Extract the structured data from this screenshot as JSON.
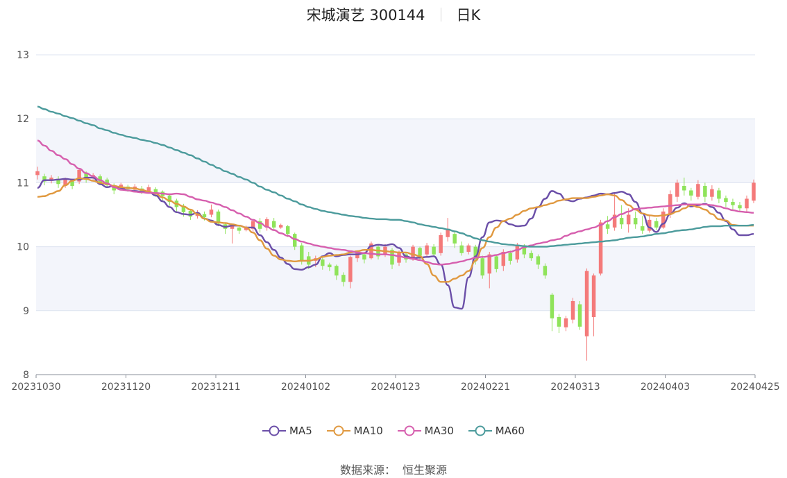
{
  "title": {
    "name": "宋城演艺 300144",
    "period": "日K"
  },
  "source": {
    "label": "数据来源：",
    "value": "恒生聚源"
  },
  "colors": {
    "up": "#f47a7a",
    "down": "#8fe35a",
    "band": "#f3f5fb",
    "grid": "#dde3f0",
    "axis": "#8a8f99"
  },
  "chart_data": {
    "type": "candlestick",
    "ylim": [
      8,
      13
    ],
    "yticks": [
      8,
      9,
      10,
      11,
      12,
      13
    ],
    "xticks": [
      "20231030",
      "20231120",
      "20231211",
      "20240102",
      "20240123",
      "20240221",
      "20240313",
      "20240403",
      "20240425"
    ],
    "series": [
      {
        "name": "MA5",
        "color": "#6b4fa8",
        "values": [
          10.92,
          11.04,
          11.04,
          11.05,
          11.06,
          11.05,
          11.05,
          11.08,
          11.08,
          10.98,
          10.93,
          10.95,
          10.92,
          10.88,
          10.87,
          10.86,
          10.86,
          10.8,
          10.71,
          10.62,
          10.54,
          10.51,
          10.5,
          10.53,
          10.44,
          10.41,
          10.34,
          10.31,
          10.33,
          10.33,
          10.3,
          10.3,
          10.18,
          10.07,
          9.95,
          9.83,
          9.73,
          9.65,
          9.64,
          9.68,
          9.72,
          9.85,
          9.9,
          9.85,
          9.87,
          9.88,
          9.88,
          9.9,
          10.01,
          10.03,
          10.02,
          10.04,
          9.98,
          9.85,
          9.82,
          9.83,
          9.84,
          9.85,
          9.72,
          9.4,
          9.05,
          9.03,
          9.52,
          9.85,
          10.15,
          10.38,
          10.41,
          10.4,
          10.35,
          10.32,
          10.33,
          10.44,
          10.62,
          10.75,
          10.87,
          10.83,
          10.73,
          10.71,
          10.75,
          10.77,
          10.8,
          10.83,
          10.82,
          10.84,
          10.86,
          10.82,
          10.7,
          10.52,
          10.3,
          10.23,
          10.36,
          10.51,
          10.61,
          10.68,
          10.63,
          10.65,
          10.67,
          10.62,
          10.53,
          10.4,
          10.27,
          10.18,
          10.18,
          10.2
        ]
      },
      {
        "name": "MA10",
        "color": "#e09940",
        "values": [
          10.78,
          10.79,
          10.83,
          10.87,
          10.96,
          11.03,
          11.07,
          11.06,
          11.03,
          11.0,
          10.98,
          10.95,
          10.93,
          10.92,
          10.91,
          10.89,
          10.86,
          10.83,
          10.77,
          10.72,
          10.67,
          10.63,
          10.58,
          10.51,
          10.44,
          10.39,
          10.38,
          10.37,
          10.35,
          10.33,
          10.3,
          10.22,
          10.1,
          9.97,
          9.86,
          9.8,
          9.78,
          9.77,
          9.78,
          9.78,
          9.8,
          9.84,
          9.86,
          9.87,
          9.88,
          9.91,
          9.93,
          9.95,
          9.95,
          9.94,
          9.93,
          9.92,
          9.91,
          9.91,
          9.88,
          9.85,
          9.73,
          9.55,
          9.45,
          9.45,
          9.5,
          9.55,
          9.62,
          9.78,
          9.98,
          10.15,
          10.3,
          10.4,
          10.44,
          10.5,
          10.56,
          10.6,
          10.62,
          10.65,
          10.68,
          10.72,
          10.74,
          10.76,
          10.76,
          10.76,
          10.78,
          10.8,
          10.82,
          10.8,
          10.73,
          10.65,
          10.58,
          10.52,
          10.49,
          10.48,
          10.49,
          10.51,
          10.55,
          10.6,
          10.65,
          10.62,
          10.58,
          10.51,
          10.43,
          10.41,
          10.34,
          10.33,
          10.33,
          10.33
        ]
      },
      {
        "name": "MA30",
        "color": "#d65fae",
        "values": [
          11.66,
          11.58,
          11.5,
          11.43,
          11.37,
          11.29,
          11.22,
          11.15,
          11.1,
          11.04,
          10.99,
          10.93,
          10.89,
          10.88,
          10.86,
          10.85,
          10.84,
          10.84,
          10.83,
          10.82,
          10.83,
          10.82,
          10.78,
          10.74,
          10.72,
          10.69,
          10.66,
          10.62,
          10.57,
          10.52,
          10.47,
          10.42,
          10.37,
          10.31,
          10.26,
          10.21,
          10.17,
          10.12,
          10.08,
          10.05,
          10.02,
          10.0,
          9.98,
          9.96,
          9.95,
          9.93,
          9.91,
          9.9,
          9.89,
          9.88,
          9.88,
          9.87,
          9.85,
          9.83,
          9.81,
          9.79,
          9.76,
          9.73,
          9.72,
          9.73,
          9.75,
          9.77,
          9.8,
          9.83,
          9.84,
          9.85,
          9.87,
          9.9,
          9.92,
          9.95,
          9.99,
          10.02,
          10.05,
          10.07,
          10.1,
          10.12,
          10.17,
          10.21,
          10.24,
          10.27,
          10.3,
          10.34,
          10.4,
          10.46,
          10.51,
          10.55,
          10.59,
          10.6,
          10.61,
          10.62,
          10.63,
          10.64,
          10.65,
          10.66,
          10.66,
          10.66,
          10.66,
          10.65,
          10.63,
          10.6,
          10.57,
          10.55,
          10.54,
          10.53
        ]
      },
      {
        "name": "MA60",
        "color": "#4c9b9c",
        "values": [
          12.19,
          12.15,
          12.11,
          12.08,
          12.04,
          12.01,
          11.97,
          11.93,
          11.9,
          11.85,
          11.82,
          11.78,
          11.75,
          11.72,
          11.7,
          11.67,
          11.65,
          11.62,
          11.59,
          11.55,
          11.51,
          11.47,
          11.43,
          11.38,
          11.33,
          11.28,
          11.23,
          11.18,
          11.14,
          11.09,
          11.05,
          11.0,
          10.94,
          10.89,
          10.85,
          10.8,
          10.75,
          10.71,
          10.66,
          10.62,
          10.59,
          10.56,
          10.54,
          10.52,
          10.5,
          10.48,
          10.47,
          10.45,
          10.44,
          10.43,
          10.43,
          10.42,
          10.42,
          10.4,
          10.38,
          10.35,
          10.33,
          10.31,
          10.29,
          10.27,
          10.24,
          10.21,
          10.17,
          10.13,
          10.1,
          10.08,
          10.06,
          10.04,
          10.03,
          10.02,
          10.01,
          10.0,
          10.0,
          10.0,
          10.01,
          10.02,
          10.03,
          10.04,
          10.05,
          10.06,
          10.07,
          10.08,
          10.09,
          10.1,
          10.12,
          10.14,
          10.15,
          10.16,
          10.18,
          10.2,
          10.21,
          10.23,
          10.25,
          10.26,
          10.27,
          10.29,
          10.31,
          10.32,
          10.32,
          10.33,
          10.33,
          10.33,
          10.33,
          10.34
        ]
      }
    ],
    "candles": [
      [
        11.12,
        11.18,
        11.05,
        11.25
      ],
      [
        11.1,
        11.02,
        10.96,
        11.14
      ],
      [
        11.03,
        11.08,
        10.99,
        11.12
      ],
      [
        11.06,
        10.98,
        10.92,
        11.1
      ],
      [
        10.96,
        11.05,
        10.92,
        11.08
      ],
      [
        11.02,
        10.95,
        10.9,
        11.06
      ],
      [
        11.02,
        11.2,
        10.98,
        11.23
      ],
      [
        11.15,
        11.05,
        11.0,
        11.18
      ],
      [
        11.1,
        11.12,
        11.05,
        11.15
      ],
      [
        11.1,
        11.0,
        10.96,
        11.13
      ],
      [
        11.05,
        10.96,
        10.92,
        11.08
      ],
      [
        10.95,
        10.88,
        10.82,
        10.99
      ],
      [
        10.93,
        10.97,
        10.9,
        11.0
      ],
      [
        10.94,
        10.9,
        10.86,
        10.97
      ],
      [
        10.89,
        10.94,
        10.85,
        10.98
      ],
      [
        10.91,
        10.87,
        10.82,
        10.95
      ],
      [
        10.86,
        10.93,
        10.83,
        10.97
      ],
      [
        10.9,
        10.83,
        10.78,
        10.93
      ],
      [
        10.86,
        10.79,
        10.72,
        10.88
      ],
      [
        10.8,
        10.7,
        10.64,
        10.83
      ],
      [
        10.72,
        10.62,
        10.55,
        10.75
      ],
      [
        10.63,
        10.54,
        10.47,
        10.67
      ],
      [
        10.56,
        10.47,
        10.42,
        10.59
      ],
      [
        10.48,
        10.53,
        10.44,
        10.57
      ],
      [
        10.51,
        10.46,
        10.41,
        10.55
      ],
      [
        10.5,
        10.58,
        10.46,
        10.66
      ],
      [
        10.55,
        10.36,
        10.32,
        10.58
      ],
      [
        10.35,
        10.28,
        10.2,
        10.38
      ],
      [
        10.28,
        10.33,
        10.05,
        10.35
      ],
      [
        10.3,
        10.25,
        10.2,
        10.34
      ],
      [
        10.26,
        10.3,
        10.24,
        10.33
      ],
      [
        10.28,
        10.4,
        10.22,
        10.43
      ],
      [
        10.4,
        10.28,
        10.22,
        10.45
      ],
      [
        10.3,
        10.43,
        10.25,
        10.46
      ],
      [
        10.4,
        10.3,
        10.25,
        10.45
      ],
      [
        10.3,
        10.34,
        10.28,
        10.36
      ],
      [
        10.32,
        10.2,
        10.15,
        10.34
      ],
      [
        10.2,
        10.0,
        9.95,
        10.22
      ],
      [
        10.02,
        9.78,
        9.72,
        10.06
      ],
      [
        9.85,
        9.72,
        9.65,
        9.92
      ],
      [
        9.78,
        9.82,
        9.68,
        9.86
      ],
      [
        9.8,
        9.7,
        9.64,
        9.83
      ],
      [
        9.72,
        9.68,
        9.62,
        9.75
      ],
      [
        9.7,
        9.55,
        9.48,
        9.72
      ],
      [
        9.56,
        9.45,
        9.38,
        9.6
      ],
      [
        9.45,
        9.84,
        9.35,
        9.86
      ],
      [
        9.82,
        9.9,
        9.76,
        9.94
      ],
      [
        9.88,
        9.8,
        9.74,
        9.92
      ],
      [
        9.82,
        10.05,
        9.8,
        10.08
      ],
      [
        10.0,
        9.85,
        9.8,
        10.03
      ],
      [
        9.88,
        10.0,
        9.84,
        10.04
      ],
      [
        9.95,
        9.72,
        9.65,
        9.98
      ],
      [
        9.75,
        9.9,
        9.7,
        9.94
      ],
      [
        9.88,
        9.8,
        9.75,
        9.92
      ],
      [
        9.82,
        10.0,
        9.78,
        10.03
      ],
      [
        9.98,
        9.86,
        9.8,
        10.0
      ],
      [
        9.88,
        10.02,
        9.84,
        10.06
      ],
      [
        10.0,
        9.88,
        9.85,
        10.04
      ],
      [
        9.9,
        10.18,
        9.86,
        10.22
      ],
      [
        10.15,
        10.28,
        10.08,
        10.45
      ],
      [
        10.2,
        10.05,
        9.98,
        10.23
      ],
      [
        10.02,
        9.9,
        9.86,
        10.08
      ],
      [
        9.92,
        10.02,
        9.88,
        10.05
      ],
      [
        10.0,
        9.8,
        9.72,
        10.03
      ],
      [
        9.82,
        9.55,
        9.5,
        9.86
      ],
      [
        9.58,
        9.88,
        9.35,
        9.92
      ],
      [
        9.85,
        9.65,
        9.6,
        9.88
      ],
      [
        9.7,
        9.92,
        9.62,
        9.96
      ],
      [
        9.9,
        9.78,
        9.72,
        9.94
      ],
      [
        9.8,
        10.02,
        9.75,
        10.06
      ],
      [
        10.0,
        9.88,
        9.82,
        10.04
      ],
      [
        9.9,
        9.82,
        9.78,
        9.94
      ],
      [
        9.85,
        9.72,
        9.65,
        9.88
      ],
      [
        9.7,
        9.55,
        9.5,
        9.74
      ],
      [
        9.25,
        8.88,
        8.68,
        9.28
      ],
      [
        8.9,
        8.75,
        8.65,
        8.95
      ],
      [
        8.74,
        8.88,
        8.68,
        8.92
      ],
      [
        8.86,
        9.15,
        8.8,
        9.2
      ],
      [
        9.1,
        8.75,
        8.7,
        9.15
      ],
      [
        8.6,
        9.62,
        8.22,
        9.66
      ],
      [
        8.9,
        9.55,
        8.6,
        9.58
      ],
      [
        9.58,
        10.38,
        9.55,
        10.42
      ],
      [
        10.35,
        10.28,
        10.2,
        10.48
      ],
      [
        10.3,
        10.5,
        10.25,
        10.85
      ],
      [
        10.45,
        10.35,
        10.28,
        10.65
      ],
      [
        10.35,
        10.5,
        10.22,
        10.6
      ],
      [
        10.45,
        10.35,
        10.28,
        10.55
      ],
      [
        10.32,
        10.25,
        10.2,
        10.48
      ],
      [
        10.25,
        10.42,
        10.22,
        10.5
      ],
      [
        10.4,
        10.3,
        10.26,
        10.45
      ],
      [
        10.3,
        10.55,
        10.28,
        10.6
      ],
      [
        10.5,
        10.82,
        10.45,
        10.88
      ],
      [
        10.78,
        11.0,
        10.7,
        11.05
      ],
      [
        10.95,
        10.88,
        10.8,
        11.08
      ],
      [
        10.88,
        10.8,
        10.72,
        10.92
      ],
      [
        10.78,
        10.98,
        10.74,
        11.04
      ],
      [
        10.95,
        10.78,
        10.7,
        11.0
      ],
      [
        10.78,
        10.9,
        10.72,
        10.96
      ],
      [
        10.88,
        10.75,
        10.68,
        10.92
      ],
      [
        10.76,
        10.7,
        10.62,
        10.8
      ],
      [
        10.7,
        10.65,
        10.58,
        10.75
      ],
      [
        10.65,
        10.6,
        10.54,
        10.7
      ],
      [
        10.6,
        10.75,
        10.55,
        10.8
      ],
      [
        10.72,
        11.0,
        10.68,
        11.05
      ]
    ]
  }
}
